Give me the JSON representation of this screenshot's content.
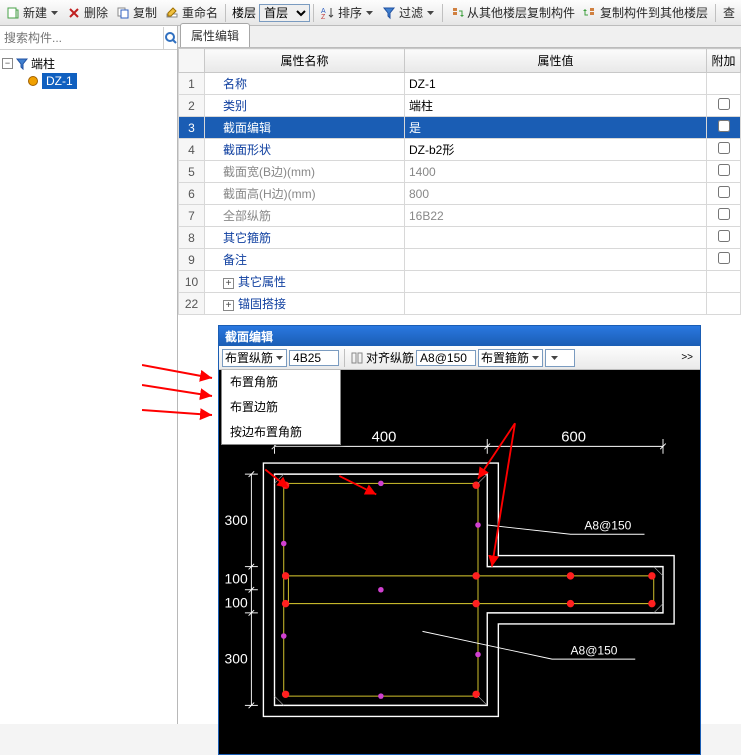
{
  "toolbar": {
    "new": "新建",
    "del": "删除",
    "copy": "复制",
    "rename": "重命名",
    "floor_label": "楼层",
    "floor_val": "首层",
    "sort": "排序",
    "filter": "过滤",
    "copy_from": "从其他楼层复制构件",
    "copy_to": "复制构件到其他楼层",
    "check": "查"
  },
  "search": {
    "placeholder": "搜索构件..."
  },
  "tree": {
    "root": "端柱",
    "item": "DZ-1"
  },
  "tab": {
    "prop": "属性编辑"
  },
  "prop": {
    "hdr_name": "属性名称",
    "hdr_val": "属性值",
    "hdr_add": "附加",
    "rows": [
      {
        "n": "1",
        "name": "名称",
        "val": "DZ-1",
        "chk": false,
        "blue": true
      },
      {
        "n": "2",
        "name": "类别",
        "val": "端柱",
        "chk": true,
        "blue": true
      },
      {
        "n": "3",
        "name": "截面编辑",
        "val": "是",
        "chk": false,
        "blue": true,
        "sel": true
      },
      {
        "n": "4",
        "name": "截面形状",
        "val": "DZ-b2形",
        "chk": false,
        "blue": true
      },
      {
        "n": "5",
        "name": "截面宽(B边)(mm)",
        "val": "1400",
        "chk": false,
        "gray": true
      },
      {
        "n": "6",
        "name": "截面高(H边)(mm)",
        "val": "800",
        "chk": false,
        "gray": true
      },
      {
        "n": "7",
        "name": "全部纵筋",
        "val": "16B22",
        "chk": false,
        "gray": true
      },
      {
        "n": "8",
        "name": "其它箍筋",
        "val": "",
        "chk": true,
        "blue": true
      },
      {
        "n": "9",
        "name": "备注",
        "val": "",
        "chk": true,
        "blue": true
      },
      {
        "n": "10",
        "name": "其它属性",
        "val": "",
        "group": true
      },
      {
        "n": "22",
        "name": "锚固搭接",
        "val": "",
        "group": true
      }
    ]
  },
  "cad": {
    "title": "截面编辑",
    "layout_rebar": "布置纵筋",
    "rebar_val": "4B25",
    "align_rebar": "对齐纵筋",
    "stirrup_val": "A8@150",
    "layout_stirrup": "布置箍筋",
    "menu": [
      "布置角筋",
      "布置边筋",
      "按边布置角筋"
    ],
    "dim_400": "400",
    "dim_600": "600",
    "dim_300a": "300",
    "dim_100a": "100",
    "dim_100b": "100",
    "dim_300b": "300",
    "label1": "A8@150",
    "label2": "A8@150"
  }
}
